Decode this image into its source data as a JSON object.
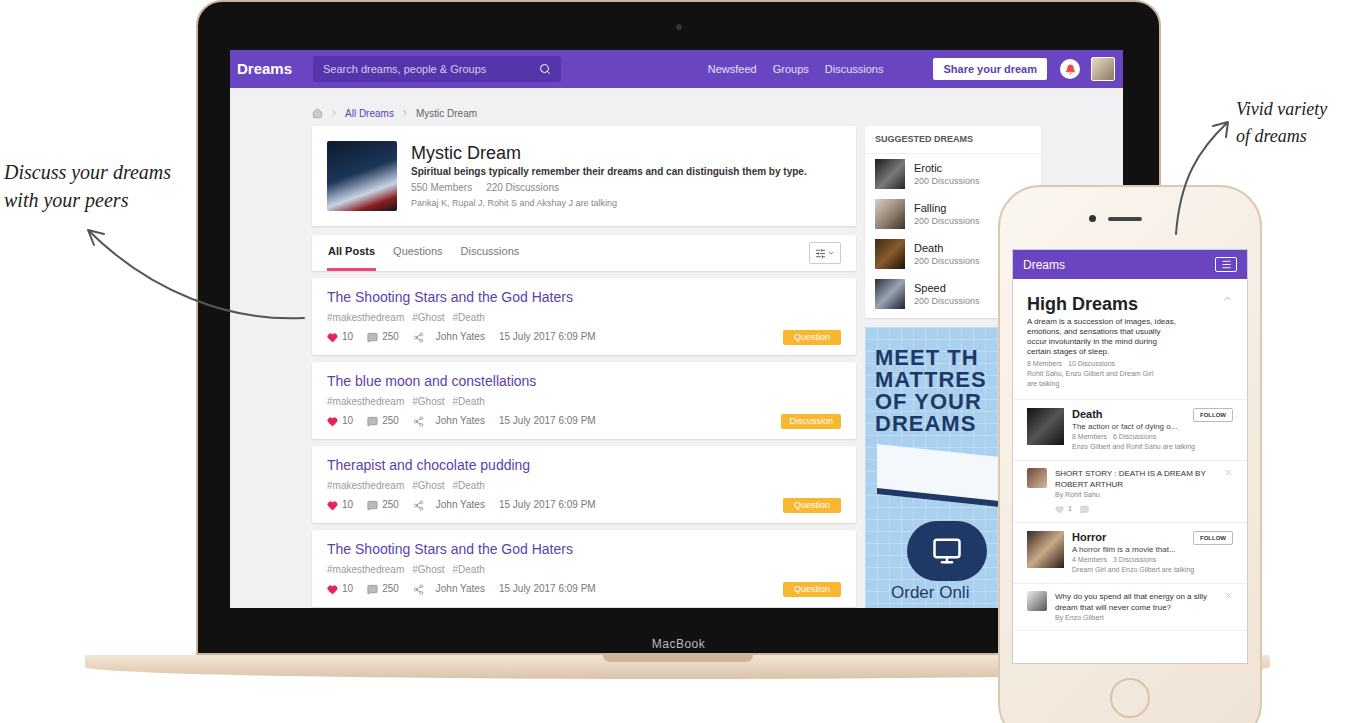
{
  "annotations": [
    {
      "lines": [
        "Discuss your dreams",
        "with your peers"
      ]
    },
    {
      "lines": [
        "Vivid variety",
        "of dreams"
      ]
    }
  ],
  "laptop": {
    "brand": "MacBook",
    "nav": {
      "logo": "Dreams",
      "search_placeholder": "Search dreams, people & Groups",
      "links": [
        "Newsfeed",
        "Groups",
        "Discussions"
      ],
      "cta": "Share your dream"
    },
    "breadcrumb": [
      "All Dreams",
      "Mystic Dream"
    ],
    "group": {
      "title": "Mystic Dream",
      "description": "Spiritual beings typically remember their dreams and can distinguish them by type.",
      "members": "550 Members",
      "discussions": "220 Discussions",
      "talking": "Pankaj K, Rupal J, Rohit S and Akshay J are talking"
    },
    "tabs": [
      {
        "label": "All Posts",
        "selected": true
      },
      {
        "label": "Questions",
        "selected": false
      },
      {
        "label": "Discussions",
        "selected": false
      }
    ],
    "posts": [
      {
        "title": "The Shooting Stars and the God Haters",
        "tags": [
          "#makesthedream",
          "#Ghost",
          "#Death"
        ],
        "likes": "10",
        "comments": "250",
        "author": "John Yates",
        "date": "15 July 2017 6:09 PM",
        "badge": "Question"
      },
      {
        "title": "The blue moon and constellations",
        "tags": [
          "#makesthedream",
          "#Ghost",
          "#Death"
        ],
        "likes": "10",
        "comments": "250",
        "author": "John Yates",
        "date": "15 July 2017 6:09 PM",
        "badge": "Discussion"
      },
      {
        "title": "Therapist and chocolate pudding",
        "tags": [
          "#makesthedream",
          "#Ghost",
          "#Death"
        ],
        "likes": "10",
        "comments": "250",
        "author": "John Yates",
        "date": "15 July 2017 6:09 PM",
        "badge": "Question"
      },
      {
        "title": "The Shooting Stars and the God Haters",
        "tags": [
          "#makesthedream",
          "#Ghost",
          "#Death"
        ],
        "likes": "10",
        "comments": "250",
        "author": "John Yates",
        "date": "15 July 2017 6:09 PM",
        "badge": "Question"
      }
    ],
    "sidebar": {
      "title": "SUGGESTED DREAMS",
      "items": [
        {
          "name": "Erotic",
          "discussions": "200 Discussions"
        },
        {
          "name": "Falling",
          "discussions": "200 Discussions"
        },
        {
          "name": "Death",
          "discussions": "200 Discussions"
        },
        {
          "name": "Speed",
          "discussions": "200 Discussions"
        }
      ]
    },
    "ad": {
      "lines": [
        "MEET TH",
        "MATTRES",
        "OF YOUR",
        "DREAMS"
      ],
      "cta": "Order Onli"
    }
  },
  "phone": {
    "nav_title": "Dreams",
    "group": {
      "title": "High Dreams",
      "description": "A dream is a succession of images, ideas, emotions, and sensations that usually occur involuntarily in the mind during certain stages of sleep.",
      "members": "8 Members",
      "discussions": "10 Discussions",
      "talking": "Rohit Sahu, Enzo Gilbert and Dream Girl are talking"
    },
    "feed": [
      {
        "kind": "group",
        "name": "Death",
        "description": "The action or fact of dying o...",
        "members": "8 Members",
        "discussions": "6 Discussions",
        "talking": "Enzo Gilbert and Rohit Sahu are talking",
        "follow": "FOLLOW"
      },
      {
        "kind": "post",
        "text": "SHORT STORY : DEATH IS A DREAM BY ROBERT ARTHUR",
        "by": "By Rohit Sahu",
        "likes": "1"
      },
      {
        "kind": "group",
        "name": "Horror",
        "description": "A horror film is a movie that...",
        "members": "4 Members",
        "discussions": "3 Discussions",
        "talking": "Dream Girl and Enzo Gilbert are talking",
        "follow": "FOLLOW"
      },
      {
        "kind": "post",
        "text": "Why do you spend all that energy on a silly dream that will never come true?",
        "by": "By Enzo Gilbert"
      }
    ]
  }
}
